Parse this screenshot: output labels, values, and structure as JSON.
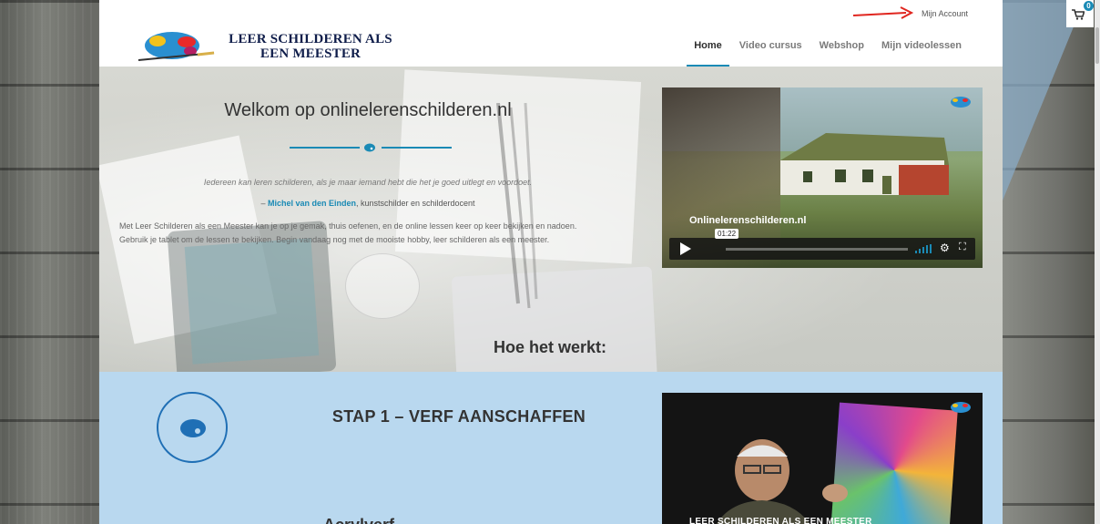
{
  "topbar": {
    "account_link": "Mijn Account",
    "cart_count": "0"
  },
  "header": {
    "logo_line1": "LEER SCHILDEREN ALS",
    "logo_line2": "EEN MEESTER",
    "nav": [
      {
        "label": "Home",
        "active": true
      },
      {
        "label": "Video cursus",
        "active": false
      },
      {
        "label": "Webshop",
        "active": false
      },
      {
        "label": "Mijn videolessen",
        "active": false
      }
    ]
  },
  "hero": {
    "title": "Welkom op onlinelerenschilderen.nl",
    "quote": "Iedereen kan leren schilderen, als je maar iemand hebt die het je goed uitlegt en voordoet.",
    "author_prefix": "– ",
    "author": "Michel van den Einden",
    "author_role": ", kunstschilder en schilderdocent",
    "intro_line1": "Met Leer Schilderen als een Meester kan je op je gemak, thuis oefenen, en de online lessen keer op keer bekijken en nadoen.",
    "intro_line2": "Gebruik je tablet om de lessen te bekijken. Begin vandaag nog met de mooiste hobby, leer schilderen als een meester.",
    "video": {
      "title": "Onlinelerenschilderen.nl",
      "time": "01:22"
    },
    "how_title": "Hoe het werkt:"
  },
  "steps": {
    "step1_title": "STAP 1 – VERF AANSCHAFFEN",
    "step1_sub": "Acrylverf",
    "video_title": "LEER SCHILDEREN ALS EEN MEESTER"
  },
  "colors": {
    "accent": "#1a8ab5",
    "steps_bg": "#b9d8ef",
    "logo_text": "#0f1d4a",
    "arrow": "#e0261f"
  }
}
